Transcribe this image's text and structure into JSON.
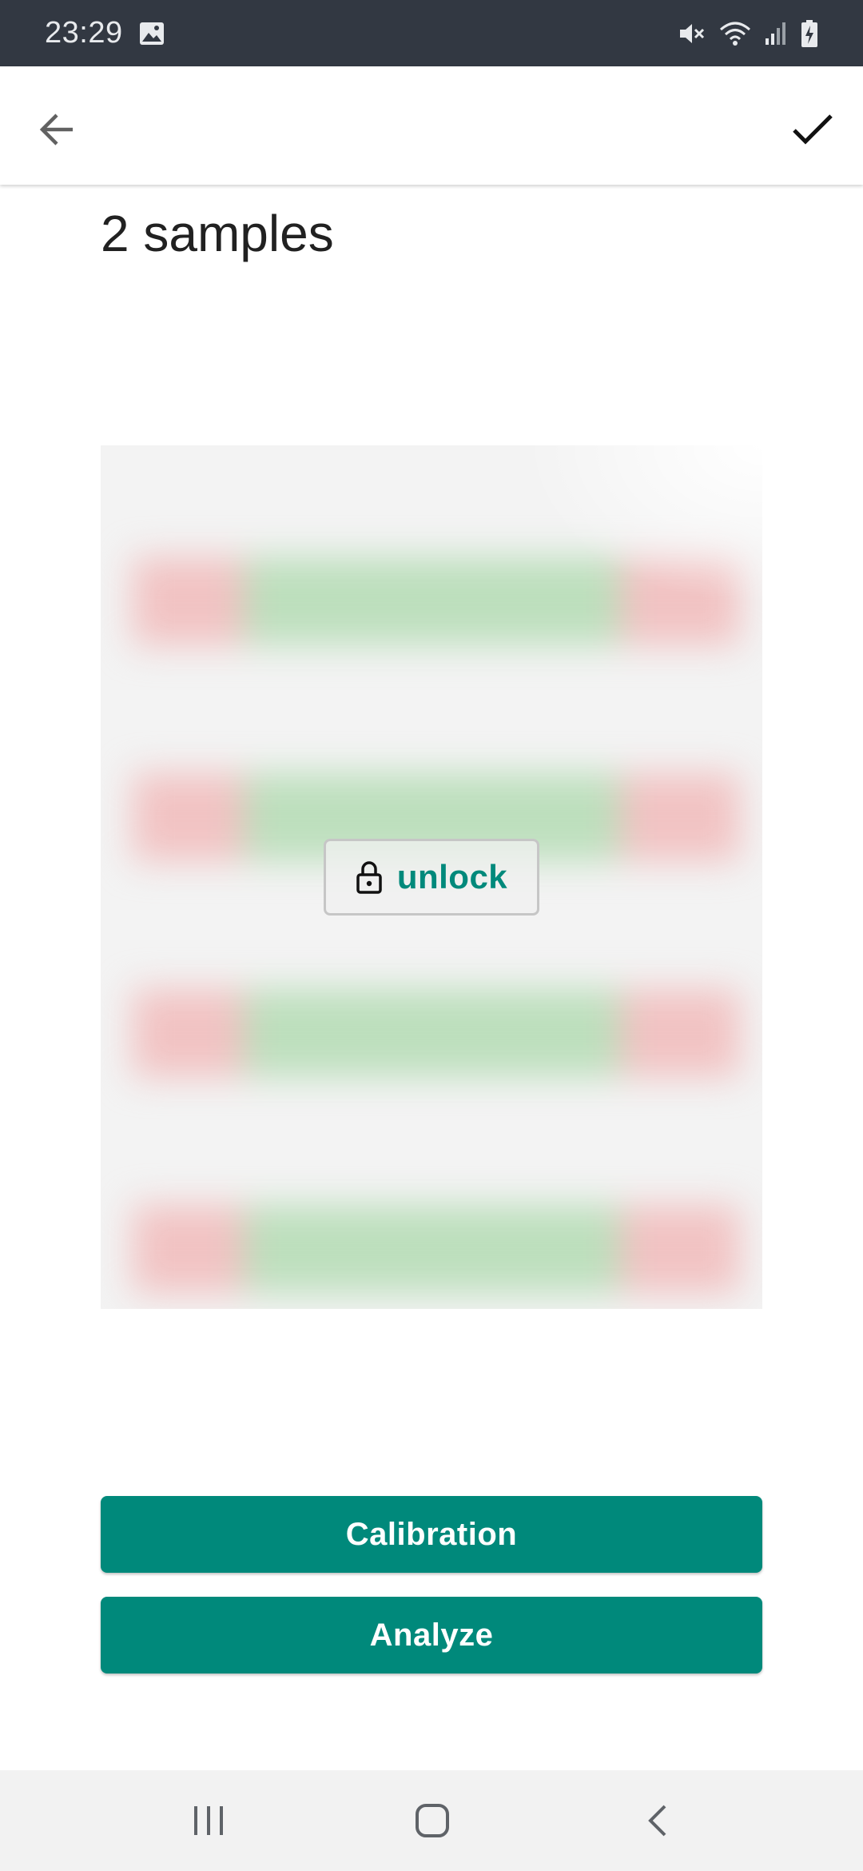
{
  "status_bar": {
    "time": "23:29",
    "icons": [
      "gallery-icon",
      "mute-icon",
      "wifi-icon",
      "signal-icon",
      "battery-charging-icon"
    ]
  },
  "app_bar": {
    "back_icon": "arrow-left-icon",
    "confirm_icon": "check-icon"
  },
  "page": {
    "title": "2 samples"
  },
  "preview": {
    "unlock_label": "unlock",
    "unlock_icon": "lock-icon"
  },
  "actions": {
    "calibration_label": "Calibration",
    "analyze_label": "Analyze"
  },
  "nav_bar": {
    "icons": [
      "recents-icon",
      "home-icon",
      "back-icon"
    ]
  },
  "colors": {
    "accent": "#00897b",
    "status_bar": "#323842",
    "nav_bar": "#f2f2f2"
  }
}
